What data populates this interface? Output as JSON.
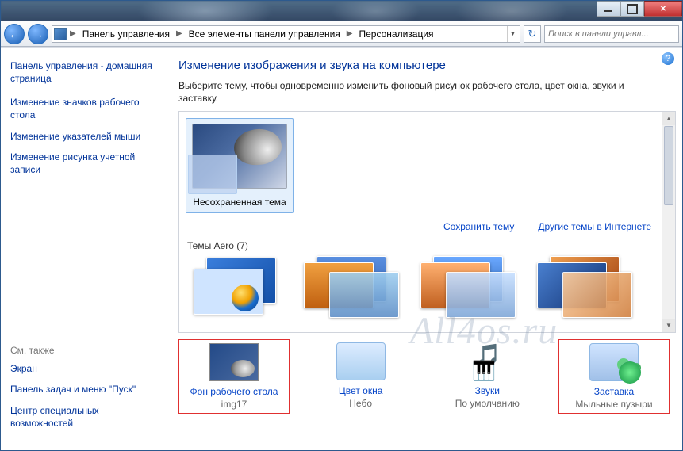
{
  "breadcrumb": {
    "items": [
      "Панель управления",
      "Все элементы панели управления",
      "Персонализация"
    ]
  },
  "search": {
    "placeholder": "Поиск в панели управл..."
  },
  "sidebar": {
    "home": "Панель управления - домашняя страница",
    "links": [
      "Изменение значков рабочего стола",
      "Изменение указателей мыши",
      "Изменение рисунка учетной записи"
    ],
    "see_also_label": "См. также",
    "see_also": [
      "Экран",
      "Панель задач и меню \"Пуск\"",
      "Центр специальных возможностей"
    ]
  },
  "page": {
    "title": "Изменение изображения и звука на компьютере",
    "description": "Выберите тему, чтобы одновременно изменить фоновый рисунок рабочего стола, цвет окна, звуки и заставку."
  },
  "themes": {
    "unsaved_label": "Несохраненная тема",
    "save_link": "Сохранить тему",
    "online_link": "Другие темы в Интернете",
    "aero_section": "Темы Aero (7)"
  },
  "bottom": {
    "items": [
      {
        "label": "Фон рабочего стола",
        "value": "img17"
      },
      {
        "label": "Цвет окна",
        "value": "Небо"
      },
      {
        "label": "Звуки",
        "value": "По умолчанию"
      },
      {
        "label": "Заставка",
        "value": "Мыльные пузыри"
      }
    ]
  },
  "watermark": "All4os.ru"
}
